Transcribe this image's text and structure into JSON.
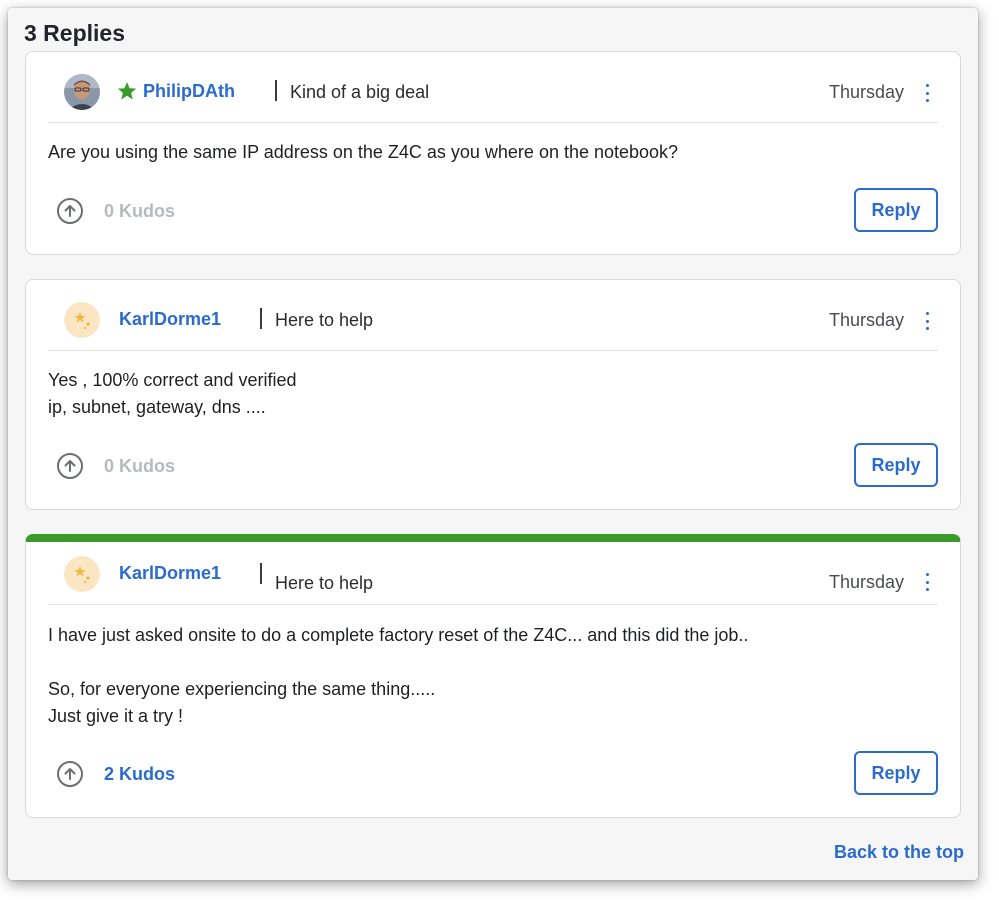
{
  "replies_heading": "3 Replies",
  "colors": {
    "link": "#2b6bce",
    "solution_accent": "#3b9a29",
    "kudos_inactive": "#b6b9be"
  },
  "replies": [
    {
      "author": "PhilipDAth",
      "rank_icon": "green-star-icon",
      "rank": "Kind of a big deal",
      "date": "Thursday",
      "body": [
        "Are you using the same IP address on the Z4C as you where on the notebook?"
      ],
      "kudos": "0 Kudos",
      "reply_label": "Reply"
    },
    {
      "author": "KarlDorme1",
      "rank": "Here to help",
      "date": "Thursday",
      "body": [
        "Yes , 100% correct and verified",
        "ip, subnet, gateway, dns ...."
      ],
      "kudos": "0 Kudos",
      "reply_label": "Reply"
    },
    {
      "author": "KarlDorme1",
      "rank": "Here to help",
      "date": "Thursday",
      "body": [
        "I have just asked onsite to do a complete factory reset of the Z4C... and this did the job..",
        "So, for everyone experiencing the same thing.....",
        "Just give it a try !"
      ],
      "kudos": "2 Kudos",
      "reply_label": "Reply",
      "accepted_solution": true
    }
  ],
  "back_to_top": "Back to the top"
}
